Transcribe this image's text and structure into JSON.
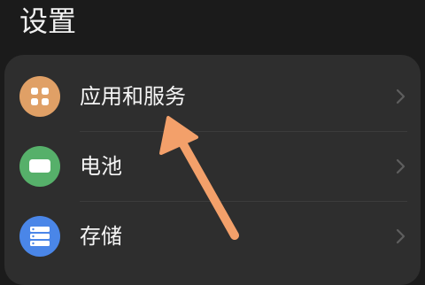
{
  "page": {
    "title": "设置"
  },
  "settings_list": {
    "items": [
      {
        "label": "应用和服务",
        "icon": "apps-grid-icon",
        "icon_color": "#e0a066"
      },
      {
        "label": "电池",
        "icon": "battery-icon",
        "icon_color": "#56b06a"
      },
      {
        "label": "存储",
        "icon": "storage-icon",
        "icon_color": "#4a86e8"
      }
    ]
  },
  "annotation": {
    "arrow_color": "#f3a06a"
  }
}
